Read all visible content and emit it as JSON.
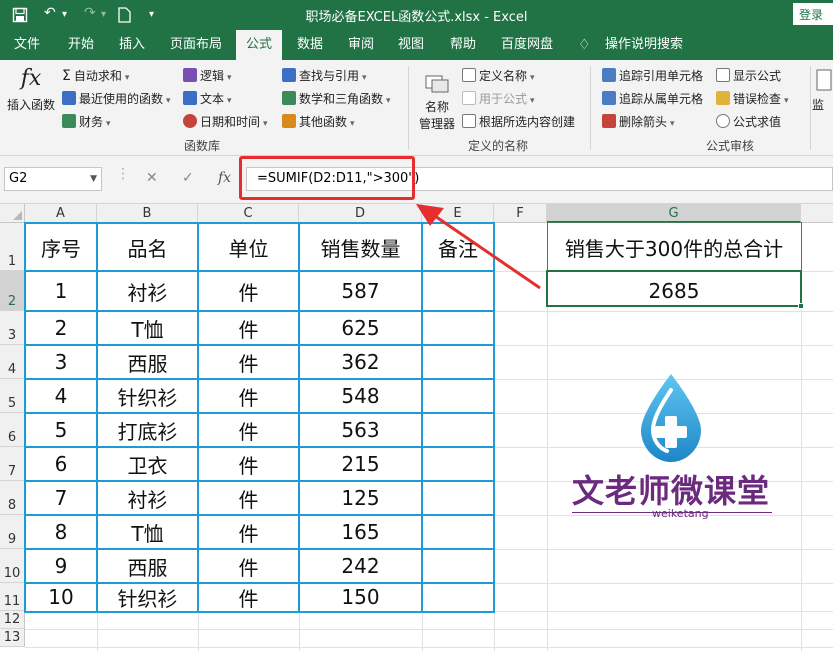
{
  "window": {
    "title": "职场必备EXCEL函数公式.xlsx  -  Excel",
    "login_label": "登录",
    "accent": "#217346"
  },
  "quick_access": [
    "save-icon",
    "undo-icon",
    "redo-icon",
    "new-file-icon",
    "customize-icon"
  ],
  "tabs": [
    {
      "label": "文件"
    },
    {
      "label": "开始"
    },
    {
      "label": "插入"
    },
    {
      "label": "页面布局"
    },
    {
      "label": "公式",
      "active": true
    },
    {
      "label": "数据"
    },
    {
      "label": "审阅"
    },
    {
      "label": "视图"
    },
    {
      "label": "帮助"
    },
    {
      "label": "百度网盘"
    },
    {
      "label": "操作说明搜索"
    }
  ],
  "ribbon": {
    "insert_function": {
      "icon": "fx",
      "label": "插入函数"
    },
    "library": {
      "autosum": "自动求和",
      "recent": "最近使用的函数",
      "financial": "财务",
      "logical": "逻辑",
      "text": "文本",
      "datetime": "日期和时间",
      "lookup": "查找与引用",
      "math": "数学和三角函数",
      "more": "其他函数",
      "group": "函数库"
    },
    "names": {
      "manager": "名称\n管理器",
      "manager_line1": "名称",
      "manager_line2": "管理器",
      "define": "定义名称",
      "use_in": "用于公式",
      "create": "根据所选内容创建",
      "group": "定义的名称"
    },
    "audit": {
      "trace_precedents": "追踪引用单元格",
      "trace_dependents": "追踪从属单元格",
      "remove_arrows": "删除箭头",
      "show_formulas": "显示公式",
      "error_check": "错误检查",
      "evaluate": "公式求值",
      "group": "公式审核",
      "watch": "监"
    }
  },
  "formula_bar": {
    "name_box": "G2",
    "cancel_icon": "✕",
    "enter_icon": "✓",
    "fx_label": "fx",
    "formula": "=SUMIF(D2:D11,\">300\")"
  },
  "sheet": {
    "columns": [
      "A",
      "B",
      "C",
      "D",
      "E",
      "F",
      "G"
    ],
    "rows": [
      "1",
      "2",
      "3",
      "4",
      "5",
      "6",
      "7",
      "8",
      "9",
      "10",
      "11",
      "12",
      "13"
    ],
    "headers": [
      "序号",
      "品名",
      "单位",
      "销售数量",
      "备注"
    ],
    "data": [
      [
        "1",
        "衬衫",
        "件",
        "587",
        ""
      ],
      [
        "2",
        "T恤",
        "件",
        "625",
        ""
      ],
      [
        "3",
        "西服",
        "件",
        "362",
        ""
      ],
      [
        "4",
        "针织衫",
        "件",
        "548",
        ""
      ],
      [
        "5",
        "打底衫",
        "件",
        "563",
        ""
      ],
      [
        "6",
        "卫衣",
        "件",
        "215",
        ""
      ],
      [
        "7",
        "衬衫",
        "件",
        "125",
        ""
      ],
      [
        "8",
        "T恤",
        "件",
        "165",
        ""
      ],
      [
        "9",
        "西服",
        "件",
        "242",
        ""
      ],
      [
        "10",
        "针织衫",
        "件",
        "150",
        ""
      ]
    ],
    "result_label": "销售大于300件的总合计",
    "result_value": "2685",
    "selected_cell": "G2"
  },
  "watermark": {
    "title": "文老师微课堂",
    "subtitle": "weiketang"
  }
}
